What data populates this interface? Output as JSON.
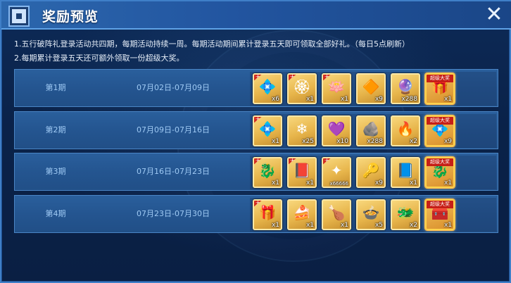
{
  "window": {
    "title": "奖励预览"
  },
  "notes": [
    "1.五行破阵礼登录活动共四期，每期活动持续一周。每期活动期间累计登录五天即可领取全部好礼。（每日5点刷新）",
    "2.每期累计登录五天还可额外领取一份超级大奖。"
  ],
  "tag_text": "大奖",
  "super_tag_text": "超级大奖",
  "rows": [
    {
      "label": "第1期",
      "date": "07月02日-07月09日",
      "items": [
        {
          "icon": "blue-crystal-icon",
          "glyph": "💠",
          "count": "x6",
          "tag": true
        },
        {
          "icon": "gold-medallion-icon",
          "glyph": "🏵",
          "count": "x1",
          "tag": true
        },
        {
          "icon": "purple-lotus-icon",
          "glyph": "🪷",
          "count": "x1",
          "tag": true
        },
        {
          "icon": "gold-stone-icon",
          "glyph": "🔶",
          "count": "x9",
          "tag": false
        },
        {
          "icon": "purple-crystal-icon",
          "glyph": "🔮",
          "count": "x288",
          "tag": false
        },
        {
          "icon": "treasure-chest-icon",
          "glyph": "🎁",
          "count": "x1",
          "super": true
        }
      ]
    },
    {
      "label": "第2期",
      "date": "07月09日-07月16日",
      "items": [
        {
          "icon": "blue-crystal-icon",
          "glyph": "💠",
          "count": "x1",
          "tag": true
        },
        {
          "icon": "blue-petals-icon",
          "glyph": "❄",
          "count": "x25",
          "tag": false
        },
        {
          "icon": "purple-gem-icon",
          "glyph": "💜",
          "count": "x10",
          "tag": false
        },
        {
          "icon": "gold-ore-icon",
          "glyph": "🪨",
          "count": "x288",
          "tag": false
        },
        {
          "icon": "fire-orb-icon",
          "glyph": "🔥",
          "count": "x2",
          "tag": false
        },
        {
          "icon": "blue-crystal-icon",
          "glyph": "💠",
          "count": "x9",
          "super": true
        }
      ]
    },
    {
      "label": "第3期",
      "date": "07月16日-07月23日",
      "items": [
        {
          "icon": "dragon-chest-icon",
          "glyph": "🐉",
          "count": "x1",
          "tag": true
        },
        {
          "icon": "red-book-icon",
          "glyph": "📕",
          "count": "x1",
          "tag": true
        },
        {
          "icon": "star-fragment-icon",
          "glyph": "✦",
          "count": "x66666",
          "small": true,
          "tag": true
        },
        {
          "icon": "gold-key-icon",
          "glyph": "🔑",
          "count": "x9",
          "tag": false
        },
        {
          "icon": "purple-book-icon",
          "glyph": "📘",
          "count": "x1",
          "tag": false
        },
        {
          "icon": "dragon-chest-icon",
          "glyph": "🐉",
          "count": "x1",
          "super": true
        }
      ]
    },
    {
      "label": "第4期",
      "date": "07月23日-07月30日",
      "items": [
        {
          "icon": "red-gift-icon",
          "glyph": "🎁",
          "count": "x1",
          "tag": true
        },
        {
          "icon": "cake-icon",
          "glyph": "🍰",
          "count": "x1",
          "tag": false
        },
        {
          "icon": "roast-food-icon",
          "glyph": "🍗",
          "count": "x1",
          "tag": false
        },
        {
          "icon": "soup-bowl-icon",
          "glyph": "🍲",
          "count": "x5",
          "tag": false
        },
        {
          "icon": "gold-dragon-icon",
          "glyph": "🐲",
          "count": "x2",
          "tag": false
        },
        {
          "icon": "red-chest-icon",
          "glyph": "🧰",
          "count": "x1",
          "super": true
        }
      ]
    }
  ]
}
